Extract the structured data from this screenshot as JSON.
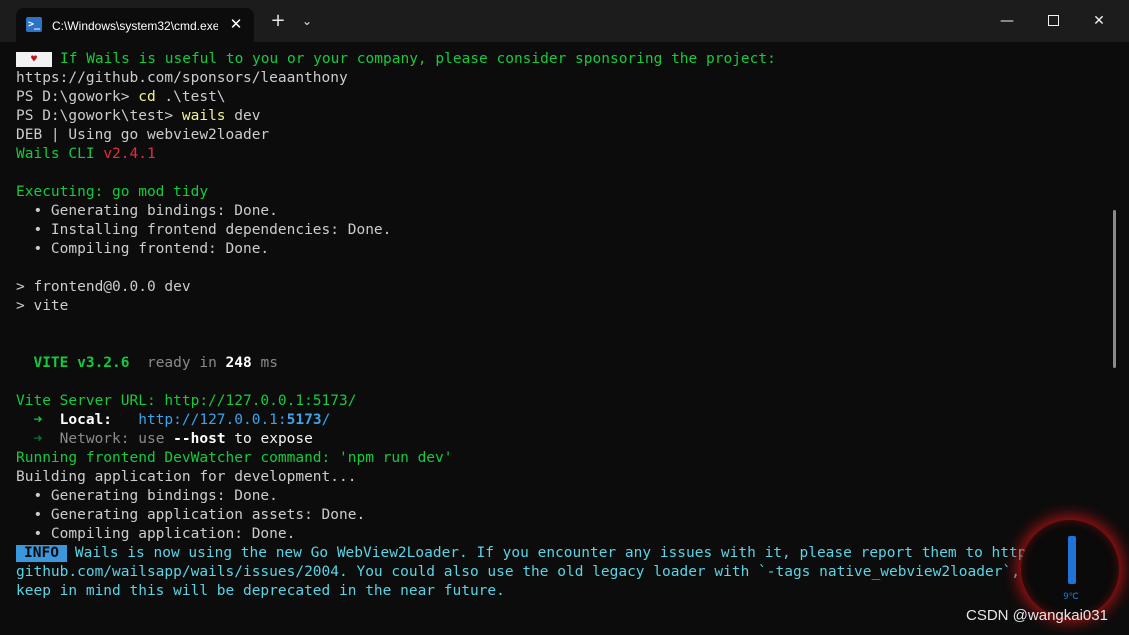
{
  "titlebar": {
    "tab_icon_glyph": ">_",
    "tab_title": "C:\\Windows\\system32\\cmd.exe",
    "tab_close": "✕",
    "new_tab": "+",
    "dropdown": "⌄",
    "minimize": "—",
    "close": "✕"
  },
  "terminal": {
    "l1_badge": "♥",
    "l1_text": "If Wails is useful to you or your company, please consider sponsoring the project:",
    "l2": "https://github.com/sponsors/leaanthony",
    "l3_prompt": "PS D:\\gowork> ",
    "l3_cmd": "cd",
    "l3_arg": " .\\test\\",
    "l4_prompt": "PS D:\\gowork\\test> ",
    "l4_cmd": "wails",
    "l4_arg": " dev",
    "l5": "DEB | Using go webview2loader",
    "l6_name": "Wails CLI ",
    "l6_version": "v2.4.1",
    "l8": "Executing: go mod tidy",
    "l9": "  • Generating bindings: Done.",
    "l10": "  • Installing frontend dependencies: Done.",
    "l11": "  • Compiling frontend: Done.",
    "l13": "> frontend@0.0.0 dev",
    "l14": "> vite",
    "l17_vite": "  VITE v3.2.6",
    "l17_ready": "  ready in ",
    "l17_ms": "248",
    "l17_unit": " ms",
    "l19": "Vite Server URL: http://127.0.0.1:5173/",
    "l20_arrow": "  ➜",
    "l20_label": "  Local:",
    "l20_url": "   http://127.0.0.1:",
    "l20_port": "5173",
    "l20_slash": "/",
    "l21_arrow": "  ➜",
    "l21_label": "  Network:",
    "l21_use": " use ",
    "l21_host": "--host",
    "l21_rest": " to expose",
    "l22": "Running frontend DevWatcher command: 'npm run dev'",
    "l23": "Building application for development...",
    "l24": "  • Generating bindings: Done.",
    "l25": "  • Generating application assets: Done.",
    "l26": "  • Compiling application: Done.",
    "l27_badge": "INFO",
    "l27_text": "Wails is now using the new Go WebView2Loader. If you encounter any issues with it, please report them to https://",
    "l28": "github.com/wailsapp/wails/issues/2004. You could also use the old legacy loader with `-tags native_webview2loader`, but",
    "l29": "keep in mind this will be deprecated in the near future."
  },
  "widget_text": "9℃",
  "watermark": "CSDN @wangkai031"
}
